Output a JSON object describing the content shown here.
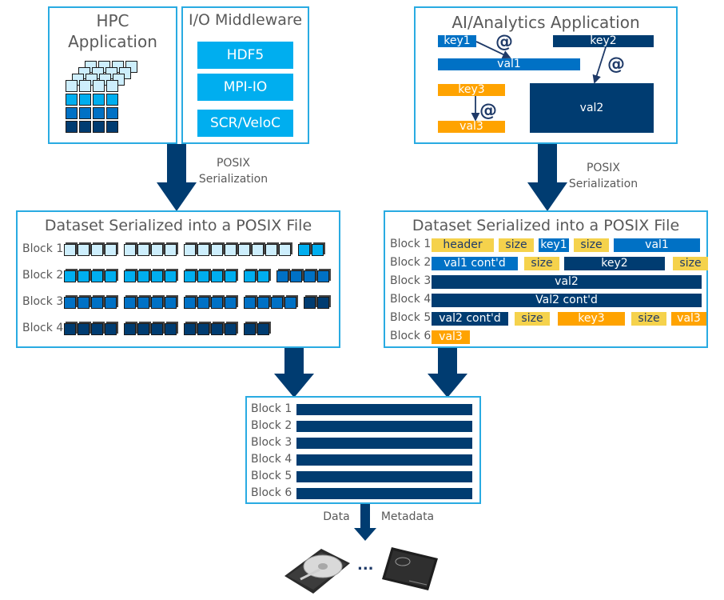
{
  "hpc_app": {
    "title_line1": "HPC",
    "title_line2": "Application"
  },
  "middleware": {
    "title": "I/O Middleware",
    "items": [
      "HDF5",
      "MPI-IO",
      "SCR/VeloC"
    ]
  },
  "ai_app": {
    "title": "AI/Analytics Application",
    "key1": "key1",
    "val1": "val1",
    "key2": "key2",
    "val2": "val2",
    "key3": "key3",
    "val3": "val3",
    "at_symbol": "@"
  },
  "arrows": {
    "left_label_line1": "POSIX",
    "left_label_line2": "Serialization",
    "right_label_line1": "POSIX",
    "right_label_line2": "Serialization",
    "bottom_left_label": "Data",
    "bottom_right_label": "Metadata"
  },
  "left_serialized": {
    "title": "Dataset Serialized into a POSIX File",
    "blocks": [
      {
        "label": "Block 1",
        "groups": [
          4,
          4,
          8,
          2
        ],
        "colors": [
          "light",
          "light",
          "light",
          "mid"
        ]
      },
      {
        "label": "Block 2",
        "groups": [
          4,
          4,
          4,
          2,
          4
        ],
        "colors": [
          "mid",
          "mid",
          "mid",
          "mid",
          "blue"
        ]
      },
      {
        "label": "Block 3",
        "groups": [
          4,
          4,
          4,
          4,
          2
        ],
        "colors": [
          "blue",
          "blue",
          "blue",
          "blue",
          "navy"
        ]
      },
      {
        "label": "Block 4",
        "groups": [
          4,
          4,
          4,
          2
        ],
        "colors": [
          "navy",
          "navy",
          "navy",
          "navy"
        ]
      }
    ]
  },
  "right_serialized": {
    "title": "Dataset Serialized into a POSIX File",
    "blocks": [
      {
        "label": "Block 1",
        "segments": [
          {
            "text": "header",
            "color": "yellow"
          },
          {
            "text": "size",
            "color": "yellow"
          },
          {
            "text": "key1",
            "color": "blue"
          },
          {
            "text": "size",
            "color": "yellow"
          },
          {
            "text": "val1",
            "color": "blue"
          }
        ]
      },
      {
        "label": "Block 2",
        "segments": [
          {
            "text": "val1 cont'd",
            "color": "blue"
          },
          {
            "text": "size",
            "color": "yellow"
          },
          {
            "text": "key2",
            "color": "navy"
          },
          {
            "text": "size",
            "color": "yellow"
          }
        ]
      },
      {
        "label": "Block 3",
        "segments": [
          {
            "text": "val2",
            "color": "navy"
          }
        ]
      },
      {
        "label": "Block 4",
        "segments": [
          {
            "text": "Val2 cont'd",
            "color": "navy"
          }
        ]
      },
      {
        "label": "Block 5",
        "segments": [
          {
            "text": "val2 cont'd",
            "color": "navy"
          },
          {
            "text": "size",
            "color": "yellow"
          },
          {
            "text": "key3",
            "color": "orange"
          },
          {
            "text": "size",
            "color": "yellow"
          },
          {
            "text": "val3",
            "color": "orange"
          }
        ]
      },
      {
        "label": "Block 6",
        "segments": [
          {
            "text": "val3",
            "color": "orange"
          }
        ]
      }
    ]
  },
  "storage_blocks": {
    "labels": [
      "Block 1",
      "Block 2",
      "Block 3",
      "Block 4",
      "Block 5",
      "Block 6"
    ]
  },
  "storage": {
    "ellipsis": "..."
  },
  "colors": {
    "border": "#29abe2",
    "middleware": "#00aeef",
    "navy": "#003c71",
    "blue": "#0071c5",
    "yellow": "#f5d24c",
    "orange": "#ffa300",
    "cube_light": "#cdeefc",
    "cube_mid": "#00aeef",
    "cube_blue": "#0071c5",
    "cube_navy": "#003c71"
  }
}
